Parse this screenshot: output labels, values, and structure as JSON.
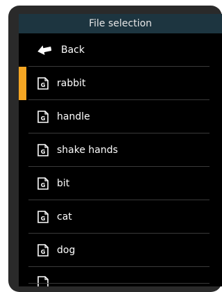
{
  "header": {
    "title": "File selection"
  },
  "back": {
    "label": "Back",
    "icon": "back-arrow-icon"
  },
  "files": [
    {
      "label": "rabbit",
      "icon": "g-file-icon",
      "selected": true
    },
    {
      "label": "handle",
      "icon": "g-file-icon",
      "selected": false
    },
    {
      "label": "shake hands",
      "icon": "g-file-icon",
      "selected": false
    },
    {
      "label": "bit",
      "icon": "g-file-icon",
      "selected": false
    },
    {
      "label": "cat",
      "icon": "g-file-icon",
      "selected": false
    },
    {
      "label": "dog",
      "icon": "g-file-icon",
      "selected": false
    }
  ],
  "colors": {
    "accent": "#f5a623",
    "header_background": "#1d3540",
    "screen_background": "#000000",
    "divider": "#3a3a3a",
    "text": "#ffffff"
  }
}
